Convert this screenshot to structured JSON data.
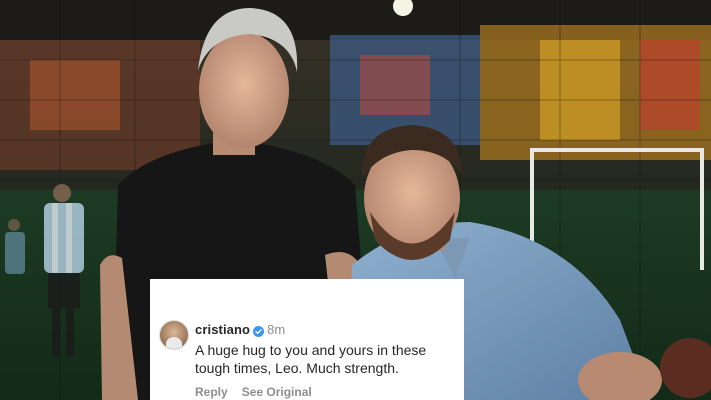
{
  "comment": {
    "username": "cristiano",
    "time": "8m",
    "text": "A huge hug to you and yours in these tough times, Leo. Much strength.",
    "reply_label": "Reply",
    "see_original_label": "See Original"
  },
  "icons": {
    "verified": "verified-badge-icon",
    "avatar": "profile-avatar"
  },
  "colors": {
    "card_background": "#ffffff",
    "username": "#262626",
    "muted_text": "#8e8e8e",
    "verified_badge": "#3897f0"
  }
}
